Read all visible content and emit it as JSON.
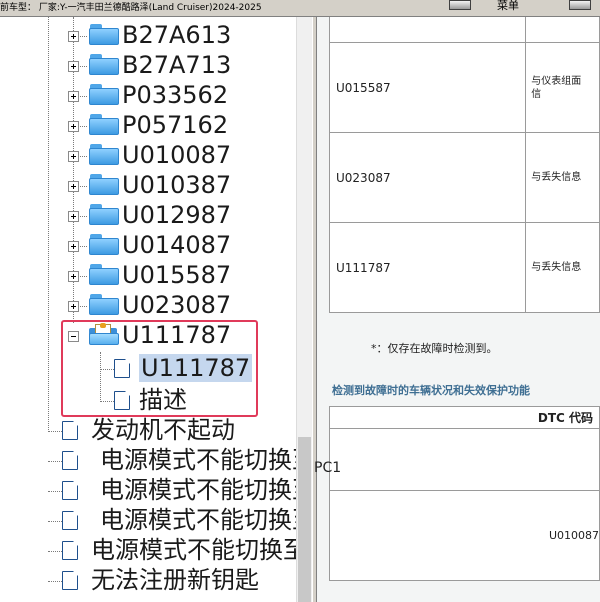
{
  "topbar": {
    "vehicle": "前车型：  厂家:Y-一汽丰田兰德酷路泽(Land Cruiser)2024-2025",
    "tool1": "菜单",
    "tool2": ""
  },
  "tree": {
    "folders": [
      "B27A613",
      "B27A713",
      "P033562",
      "P057162",
      "U010087",
      "U010387",
      "U012987",
      "U014087",
      "U015587",
      "U023087"
    ],
    "open_folder": "U111787",
    "children": [
      {
        "label": "U111787",
        "selected": true
      },
      {
        "label": "描述",
        "selected": false
      }
    ],
    "docs": [
      "发动机不起动",
      "电源模式不能切换至",
      "电源模式不能切换至",
      "电源模式不能切换至",
      "电源模式不能切换至",
      "无法注册新钥匙"
    ]
  },
  "content": {
    "rows": [
      {
        "code": "",
        "desc": ""
      },
      {
        "code": "U015587",
        "desc": "与仪表组面\n信"
      },
      {
        "code": "U023087",
        "desc": "与丢失信息"
      },
      {
        "code": "U111787",
        "desc": "与丢失信息"
      }
    ],
    "footnote": "*：仅存在故障时检测到。",
    "section_title": "检测到故障时的车辆状况和失效保护功能",
    "table2_header": "DTC 代码",
    "table2_code": "U010087",
    "cut_text": "PC1"
  },
  "colors": {
    "accent_box": "#e03a5a",
    "selected_bg": "#c5d7ee",
    "section_title": "#3f6f93"
  }
}
